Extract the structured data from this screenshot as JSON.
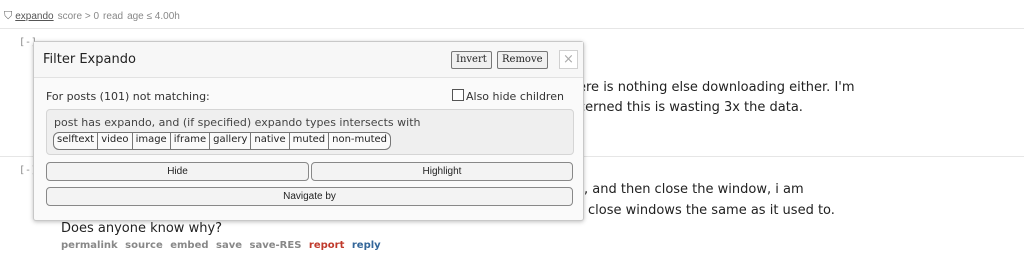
{
  "filter_line": {
    "name": "expando",
    "conditions": [
      "score > 0",
      "read",
      "age ≤ 4.00h"
    ]
  },
  "comments": [
    {
      "expander": "[-]",
      "lines_right": [
        "ere is nothing else downloading either. I'm",
        "cerned this is wasting 3x the data."
      ]
    },
    {
      "expander": "[-]",
      "lines_right": [
        ", and then close the window, i am",
        " close windows the same as it used to."
      ],
      "last_line": "Does anyone know why?"
    }
  ],
  "flat_list": {
    "permalink": "permalink",
    "source": "source",
    "embed": "embed",
    "save": "save",
    "save_res": "save-RES",
    "report": "report",
    "reply": "reply"
  },
  "popup": {
    "title": "Filter Expando",
    "invert_label": "Invert",
    "remove_label": "Remove",
    "close_label": "×",
    "not_matching": "For posts (101) not matching:",
    "also_hide_children": "Also hide children",
    "criteria_text": "post has expando, and (if specified) expando types intersects with",
    "chips": [
      "selftext",
      "video",
      "image",
      "iframe",
      "gallery",
      "native",
      "muted",
      "non-muted"
    ],
    "hide_label": "Hide",
    "highlight_label": "Highlight",
    "navigate_label": "Navigate by"
  }
}
